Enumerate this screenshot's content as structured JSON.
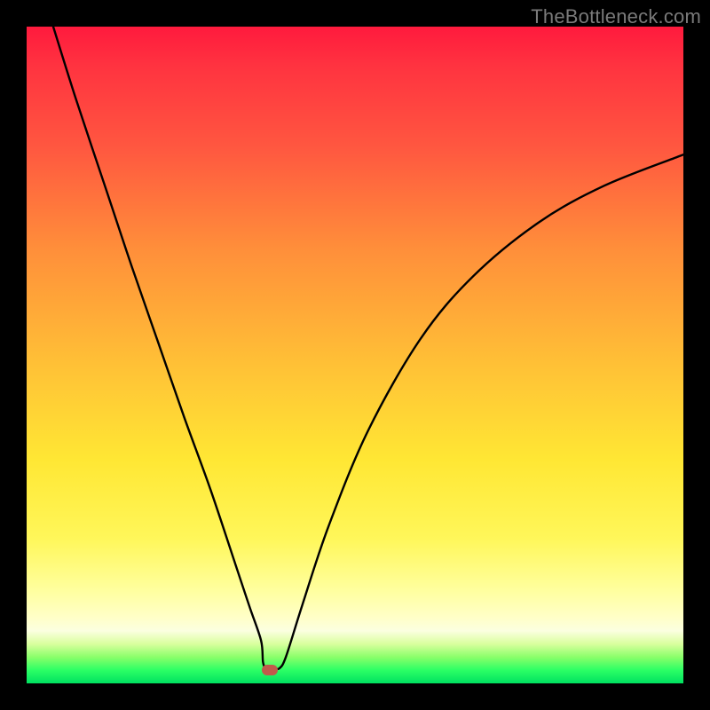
{
  "watermark": "TheBottleneck.com",
  "colors": {
    "background": "#000000",
    "gradient_top": "#ff1a3d",
    "gradient_mid": "#ffe734",
    "gradient_bottom": "#00e060",
    "curve": "#000000",
    "marker": "#c15a4b"
  },
  "chart_data": {
    "type": "line",
    "title": "",
    "xlabel": "",
    "ylabel": "",
    "xlim": [
      0,
      100
    ],
    "ylim": [
      0,
      100
    ],
    "note": "axes are unlabeled; values are percent positions read from pixels",
    "series": [
      {
        "name": "curve",
        "x": [
          4.05,
          7.5,
          12,
          16,
          20,
          24,
          28,
          32,
          34,
          35.7,
          36.0,
          36.5,
          37.7,
          38.5,
          39.5,
          42,
          46,
          52,
          60,
          68,
          78,
          88,
          100
        ],
        "y": [
          100,
          89,
          75.5,
          63.5,
          52,
          40.5,
          29.5,
          17.5,
          11.5,
          6.5,
          3.2,
          2.3,
          2.3,
          2.3,
          4.1,
          12,
          24,
          38.5,
          52.5,
          62,
          70.2,
          75.8,
          80.5
        ]
      }
    ],
    "marker": {
      "x": 37.0,
      "y": 2.0
    },
    "annotations": []
  }
}
